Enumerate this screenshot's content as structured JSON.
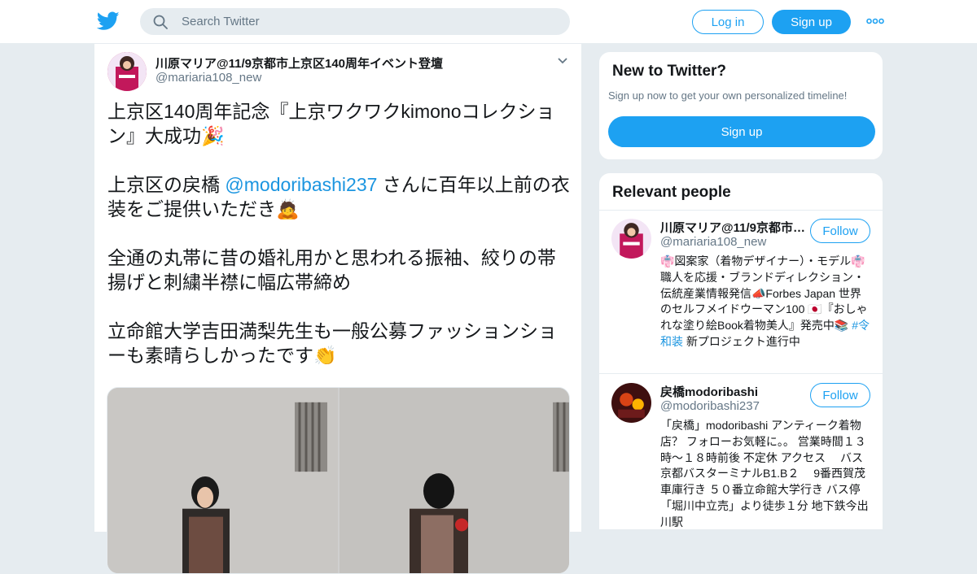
{
  "header": {
    "search_placeholder": "Search Twitter",
    "login_label": "Log in",
    "signup_label": "Sign up"
  },
  "tweet": {
    "author_name": "川原マリア@11/9京都市上京区140周年イベント登壇",
    "author_handle": "@mariaria108_new",
    "paragraphs": [
      {
        "text": "上京区140周年記念『上京ワクワクkimonoコレクション』大成功",
        "emoji": "🎉"
      },
      {
        "pre": "上京区の戻橋 ",
        "mention": "@modoribashi237",
        "post": " さんに百年以上前の衣装をご提供いただき",
        "emoji": "🙇"
      },
      {
        "text": "全通の丸帯に昔の婚礼用かと思われる振袖、絞りの帯揚げと刺繍半襟に幅広帯締め"
      },
      {
        "text": "立命館大学吉田満梨先生も一般公募ファッションショーも素晴らしかったです",
        "emoji": "👏"
      }
    ]
  },
  "sidebar": {
    "new_to_twitter": {
      "title": "New to Twitter?",
      "subtitle": "Sign up now to get your own personalized timeline!",
      "button": "Sign up"
    },
    "relevant_people": {
      "title": "Relevant people",
      "people": [
        {
          "name": "川原マリア@11/9京都市上京区140周年イベント登壇",
          "handle": "@mariaria108_new",
          "follow_label": "Follow",
          "bio_pre": "👘図案家（着物デザイナー）・モデル👘 職人を応援・ブランドディレクション・伝統産業情報発信📣Forbes Japan 世界のセルフメイドウーマン100 🇯🇵『おしゃれな塗り絵Book着物美人』発売中📚 ",
          "bio_hashtag": "#令和装",
          "bio_post": " 新プロジェクト進行中"
        },
        {
          "name": "戻橋modoribashi",
          "handle": "@modoribashi237",
          "follow_label": "Follow",
          "bio": "「戻橋」modoribashi アンティーク着物店？ フォローお気軽に。。 営業時間１３時～１８時前後 不定休 アクセス　 バス京都バスターミナルB1.B２　 9番西賀茂車庫行き ５０番立命館大学行き バス停「堀川中立売」より徒歩１分 地下鉄今出川駅"
        }
      ]
    }
  },
  "colors": {
    "accent": "#1da1f2",
    "link": "#1b95e0",
    "muted": "#657786",
    "background": "#e6ecf0"
  },
  "icons": [
    "twitter-bird-icon",
    "search-icon",
    "more-dots-icon",
    "chevron-down-icon"
  ]
}
